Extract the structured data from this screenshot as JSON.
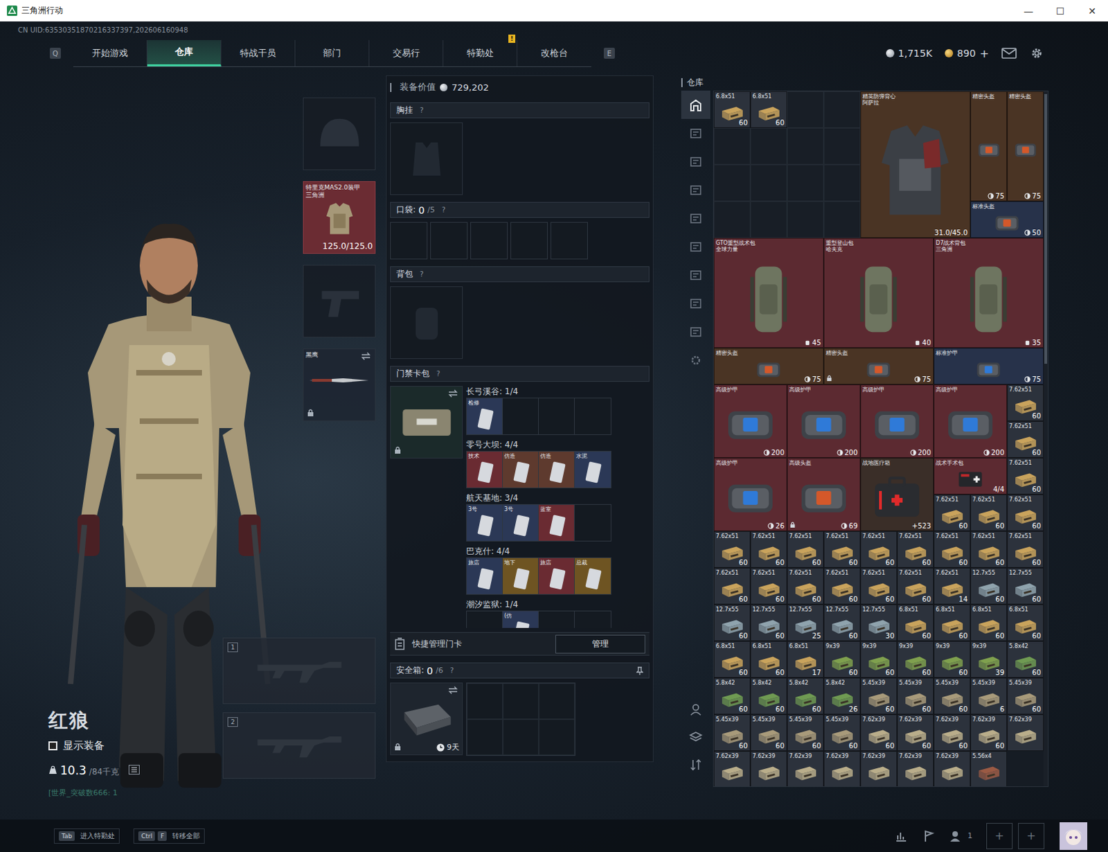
{
  "window": {
    "title": "三角洲行动",
    "controls": [
      "—",
      "☐",
      "✕"
    ]
  },
  "uid": "CN UID:63530351870216337397,202606160948",
  "nav": {
    "left_key": "Q",
    "right_key": "E",
    "tabs": [
      {
        "label": "开始游戏",
        "selected": false
      },
      {
        "label": "仓库",
        "selected": true
      },
      {
        "label": "特战干员",
        "selected": false
      },
      {
        "label": "部门",
        "selected": false
      },
      {
        "label": "交易行",
        "selected": false
      },
      {
        "label": "特勤处",
        "selected": false,
        "badge": "!"
      },
      {
        "label": "改枪台",
        "selected": false
      }
    ]
  },
  "currency": [
    {
      "amount": "1,715K",
      "kind": "silver",
      "suffix": ""
    },
    {
      "amount": "890",
      "kind": "gold",
      "suffix": "+"
    }
  ],
  "operator": {
    "name": "红狼",
    "show_gear": {
      "label": "显示装备",
      "checked": false
    },
    "weight": "10.3",
    "weight_max": "/84千克",
    "status": "[世界_突破数666: 1"
  },
  "slots": {
    "helmet": {
      "filled": false
    },
    "armor": {
      "name": "特里克MAS2.0装甲",
      "sub": "三角洲",
      "durability": "125.0/125.0",
      "color": "#6b2c33"
    },
    "pistol": {
      "filled": false
    },
    "melee": {
      "name": "黑鹰",
      "locked": true
    },
    "weapons": [
      {
        "number": "1"
      },
      {
        "number": "2"
      }
    ]
  },
  "loadout": {
    "value_label": "装备价值",
    "value": "729,202",
    "chest": {
      "label": "胸挂",
      "help": "?"
    },
    "pockets": {
      "label": "口袋:",
      "count": "0",
      "capacity": "/5",
      "help": "?",
      "slots": [
        {
          "filled": false
        },
        {
          "filled": false
        },
        {
          "filled": false
        },
        {
          "filled": false
        },
        {
          "filled": false
        }
      ]
    },
    "backpack": {
      "label": "背包",
      "help": "?"
    },
    "keycards": {
      "label": "门禁卡包",
      "help": "?",
      "locked": true,
      "groups": [
        {
          "name": "长弓溪谷:",
          "count": "1/4",
          "cards": [
            {
              "filled": true,
              "label": "检修",
              "color": "#2b3856"
            },
            {
              "filled": false
            },
            {
              "filled": false
            },
            {
              "filled": false
            }
          ]
        },
        {
          "name": "零号大坝:",
          "count": "4/4",
          "cards": [
            {
              "filled": true,
              "label": "技术",
              "color": "#6a2b32"
            },
            {
              "filled": true,
              "label": "仿造",
              "color": "#5e3a2e"
            },
            {
              "filled": true,
              "label": "仿造",
              "color": "#5e3a2e"
            },
            {
              "filled": true,
              "label": "水泥",
              "color": "#2b3856"
            }
          ]
        },
        {
          "name": "航天基地:",
          "count": "3/4",
          "cards": [
            {
              "filled": true,
              "label": "3号",
              "color": "#2b3856"
            },
            {
              "filled": true,
              "label": "3号",
              "color": "#2b3856"
            },
            {
              "filled": true,
              "label": "蓝室",
              "color": "#6a2b32"
            },
            {
              "filled": false
            }
          ]
        },
        {
          "name": "巴克什:",
          "count": "4/4",
          "cards": [
            {
              "filled": true,
              "label": "旅店",
              "color": "#2b3856"
            },
            {
              "filled": true,
              "label": "地下",
              "color": "#6e5422"
            },
            {
              "filled": true,
              "label": "旅店",
              "color": "#6a2b32"
            },
            {
              "filled": true,
              "label": "总裁",
              "color": "#6e5422"
            }
          ]
        },
        {
          "name": "潮汐监狱:",
          "count": "1/4",
          "cards": [
            {
              "filled": false
            },
            {
              "filled": true,
              "label": "(仿",
              "color": "#2b3856"
            },
            {
              "filled": false
            },
            {
              "filled": false
            }
          ]
        }
      ]
    },
    "quick_manage": {
      "label": "快捷管理门卡",
      "button": "管理"
    },
    "safe": {
      "label": "安全箱:",
      "count": "0",
      "capacity": "/6",
      "help": "?",
      "time": "9天",
      "locked": true,
      "slots": [
        {
          "filled": false
        },
        {
          "filled": false
        },
        {
          "filled": false
        },
        {
          "filled": false
        },
        {
          "filled": false
        },
        {
          "filled": false
        }
      ]
    }
  },
  "storage": {
    "title": "仓库",
    "tabs": [
      {
        "selected": true
      },
      {
        "selected": false
      },
      {
        "selected": false
      },
      {
        "selected": false
      },
      {
        "selected": false
      },
      {
        "selected": false
      },
      {
        "selected": false
      },
      {
        "selected": false
      },
      {
        "selected": false
      },
      {
        "selected": false
      }
    ],
    "items": [
      {
        "kind": "ammo",
        "name": "6.8x51",
        "count": "60",
        "color": "#c9a35c",
        "locked": false
      },
      {
        "kind": "ammo",
        "name": "6.8x51",
        "count": "60",
        "color": "#c9a35c",
        "locked": false
      },
      {
        "kind": "empty"
      },
      {
        "kind": "empty"
      },
      {
        "kind": "vest",
        "name": "精英防弹背心",
        "sub": "阿萨拉",
        "count": "31.0/45.0",
        "color": "#4a3424",
        "locked": false
      },
      {
        "kind": "helmet-tall",
        "name": "精密头盔",
        "count": "75",
        "color": "#4a3424",
        "locked": false
      },
      {
        "kind": "helmet-tall",
        "name": "精密头盔",
        "count": "75",
        "color": "#4a3424",
        "locked": false
      },
      {
        "kind": "empty"
      },
      {
        "kind": "empty"
      },
      {
        "kind": "empty"
      },
      {
        "kind": "empty"
      },
      {
        "kind": "empty"
      },
      {
        "kind": "empty"
      },
      {
        "kind": "empty"
      },
      {
        "kind": "empty"
      },
      {
        "kind": "empty"
      },
      {
        "kind": "empty"
      },
      {
        "kind": "empty"
      },
      {
        "kind": "empty"
      },
      {
        "kind": "helmet-small",
        "name": "标准头盔",
        "count": "50",
        "color": "#27324a",
        "locked": false
      },
      {
        "kind": "backpack",
        "name": "GTO重型战术包",
        "sub": "全球力量",
        "count": "45",
        "color": "#5c2a31",
        "locked": false
      },
      {
        "kind": "backpack",
        "name": "重型登山包",
        "sub": "哈夫克",
        "count": "40",
        "color": "#5c2a31",
        "locked": false
      },
      {
        "kind": "backpack",
        "name": "D7战术背包",
        "sub": "三角洲",
        "count": "35",
        "color": "#5c2a31",
        "locked": false
      },
      {
        "kind": "helmet-wide",
        "name": "精密头盔",
        "count": "75",
        "color": "#4a3424",
        "locked": false
      },
      {
        "kind": "helmet-wide",
        "name": "精密头盔",
        "count": "75",
        "color": "#4a3424",
        "locked": true
      },
      {
        "kind": "armor-wide",
        "name": "标准护甲",
        "count": "75",
        "color": "#27324a",
        "locked": false
      },
      {
        "kind": "armor",
        "name": "高级护甲",
        "count": "200",
        "color": "#5c2a31",
        "locked": false
      },
      {
        "kind": "armor",
        "name": "高级护甲",
        "count": "200",
        "color": "#5c2a31",
        "locked": false
      },
      {
        "kind": "armor",
        "name": "高级护甲",
        "count": "200",
        "color": "#5c2a31",
        "locked": false
      },
      {
        "kind": "armor",
        "name": "高级护甲",
        "count": "200",
        "color": "#5c2a31",
        "locked": false
      },
      {
        "kind": "ammo",
        "name": "7.62x51",
        "count": "60",
        "color": "#c9a35c",
        "locked": false
      },
      {
        "kind": "ammo",
        "name": "7.62x51",
        "count": "60",
        "color": "#c9a35c",
        "locked": false
      },
      {
        "kind": "armor",
        "name": "高级护甲",
        "count": "26",
        "color": "#5c2a31",
        "locked": false
      },
      {
        "kind": "helmet",
        "name": "高级头盔",
        "count": "69",
        "color": "#5c2a31",
        "locked": true
      },
      {
        "kind": "medkit",
        "name": "战地医疗箱",
        "count": "+523",
        "color": "#3a2e28",
        "locked": false
      },
      {
        "kind": "surgery",
        "name": "战术手术包",
        "count": "4/4",
        "color": "#5c2a31",
        "locked": false
      },
      {
        "kind": "ammo",
        "name": "7.62x51",
        "count": "60",
        "color": "#c9a35c",
        "locked": false
      },
      {
        "kind": "ammo",
        "name": "7.62x51",
        "count": "60",
        "color": "#c9a35c",
        "locked": false
      },
      {
        "kind": "ammo",
        "name": "7.62x51",
        "count": "60",
        "color": "#c9a35c",
        "locked": false
      },
      {
        "kind": "ammo",
        "name": "7.62x51",
        "count": "60",
        "color": "#c9a35c",
        "locked": false
      },
      {
        "kind": "ammo",
        "name": "7.62x51",
        "count": "60",
        "color": "#c9a35c",
        "locked": false
      },
      {
        "kind": "ammo",
        "name": "7.62x51",
        "count": "60",
        "color": "#c9a35c",
        "locked": false
      },
      {
        "kind": "ammo",
        "name": "7.62x51",
        "count": "60",
        "color": "#c9a35c",
        "locked": false
      },
      {
        "kind": "ammo",
        "name": "7.62x51",
        "count": "60",
        "color": "#c9a35c",
        "locked": false
      },
      {
        "kind": "ammo",
        "name": "7.62x51",
        "count": "60",
        "color": "#c9a35c",
        "locked": false
      },
      {
        "kind": "ammo",
        "name": "7.62x51",
        "count": "60",
        "color": "#c9a35c",
        "locked": false
      },
      {
        "kind": "ammo",
        "name": "7.62x51",
        "count": "60",
        "color": "#c9a35c",
        "locked": false
      },
      {
        "kind": "ammo",
        "name": "7.62x51",
        "count": "60",
        "color": "#c9a35c",
        "locked": false
      },
      {
        "kind": "ammo",
        "name": "7.62x51",
        "count": "60",
        "color": "#c9a35c",
        "locked": false
      },
      {
        "kind": "ammo",
        "name": "7.62x51",
        "count": "60",
        "color": "#c9a35c",
        "locked": false
      },
      {
        "kind": "ammo",
        "name": "7.62x51",
        "count": "60",
        "color": "#c9a35c",
        "locked": false
      },
      {
        "kind": "ammo",
        "name": "7.62x51",
        "count": "60",
        "color": "#c9a35c",
        "locked": false
      },
      {
        "kind": "ammo",
        "name": "7.62x51",
        "count": "60",
        "color": "#c9a35c",
        "locked": false
      },
      {
        "kind": "ammo",
        "name": "7.62x51",
        "count": "60",
        "color": "#c9a35c",
        "locked": false
      },
      {
        "kind": "ammo",
        "name": "7.62x51",
        "count": "60",
        "color": "#c9a35c",
        "locked": false
      },
      {
        "kind": "ammo",
        "name": "7.62x51",
        "count": "14",
        "color": "#c9a35c",
        "locked": false
      },
      {
        "kind": "ammo",
        "name": "12.7x55",
        "count": "60",
        "color": "#8fa3ad",
        "locked": false
      },
      {
        "kind": "ammo",
        "name": "12.7x55",
        "count": "60",
        "color": "#8fa3ad",
        "locked": false
      },
      {
        "kind": "ammo",
        "name": "12.7x55",
        "count": "60",
        "color": "#8fa3ad",
        "locked": false
      },
      {
        "kind": "ammo",
        "name": "12.7x55",
        "count": "60",
        "color": "#8fa3ad",
        "locked": false
      },
      {
        "kind": "ammo",
        "name": "12.7x55",
        "count": "25",
        "color": "#8fa3ad",
        "locked": false
      },
      {
        "kind": "ammo",
        "name": "12.7x55",
        "count": "60",
        "color": "#8fa3ad",
        "locked": false
      },
      {
        "kind": "ammo",
        "name": "12.7x55",
        "count": "30",
        "color": "#8fa3ad",
        "locked": false
      },
      {
        "kind": "ammo",
        "name": "6.8x51",
        "count": "60",
        "color": "#c9a35c",
        "locked": false
      },
      {
        "kind": "ammo",
        "name": "6.8x51",
        "count": "60",
        "color": "#c9a35c",
        "locked": false
      },
      {
        "kind": "ammo",
        "name": "6.8x51",
        "count": "60",
        "color": "#c9a35c",
        "locked": false
      },
      {
        "kind": "ammo",
        "name": "6.8x51",
        "count": "60",
        "color": "#c9a35c",
        "locked": false
      },
      {
        "kind": "ammo",
        "name": "6.8x51",
        "count": "60",
        "color": "#c9a35c",
        "locked": false
      },
      {
        "kind": "ammo",
        "name": "6.8x51",
        "count": "60",
        "color": "#c9a35c",
        "locked": false
      },
      {
        "kind": "ammo",
        "name": "6.8x51",
        "count": "17",
        "color": "#c9a35c",
        "locked": false
      },
      {
        "kind": "ammo",
        "name": "9x39",
        "count": "60",
        "color": "#7fa04e",
        "locked": false
      },
      {
        "kind": "ammo",
        "name": "9x39",
        "count": "60",
        "color": "#7fa04e",
        "locked": false
      },
      {
        "kind": "ammo",
        "name": "9x39",
        "count": "60",
        "color": "#7fa04e",
        "locked": false
      },
      {
        "kind": "ammo",
        "name": "9x39",
        "count": "60",
        "color": "#7fa04e",
        "locked": false
      },
      {
        "kind": "ammo",
        "name": "9x39",
        "count": "39",
        "color": "#7fa04e",
        "locked": false
      },
      {
        "kind": "ammo",
        "name": "5.8x42",
        "count": "60",
        "color": "#6f9a52",
        "locked": false
      },
      {
        "kind": "ammo",
        "name": "5.8x42",
        "count": "60",
        "color": "#6f9a52",
        "locked": false
      },
      {
        "kind": "ammo",
        "name": "5.8x42",
        "count": "60",
        "color": "#6f9a52",
        "locked": false
      },
      {
        "kind": "ammo",
        "name": "5.8x42",
        "count": "60",
        "color": "#6f9a52",
        "locked": false
      },
      {
        "kind": "ammo",
        "name": "5.8x42",
        "count": "26",
        "color": "#6f9a52",
        "locked": false
      },
      {
        "kind": "ammo",
        "name": "5.45x39",
        "count": "60",
        "color": "#a89a7a",
        "locked": false
      },
      {
        "kind": "ammo",
        "name": "5.45x39",
        "count": "60",
        "color": "#a89a7a",
        "locked": false
      },
      {
        "kind": "ammo",
        "name": "5.45x39",
        "count": "60",
        "color": "#a89a7a",
        "locked": false
      },
      {
        "kind": "ammo",
        "name": "5.45x39",
        "count": "6",
        "color": "#a89a7a",
        "locked": false
      },
      {
        "kind": "ammo",
        "name": "5.45x39",
        "count": "60",
        "color": "#a89a7a",
        "locked": false
      },
      {
        "kind": "ammo",
        "name": "5.45x39",
        "count": "60",
        "color": "#a89a7a",
        "locked": false
      },
      {
        "kind": "ammo",
        "name": "5.45x39",
        "count": "60",
        "color": "#a89a7a",
        "locked": false
      },
      {
        "kind": "ammo",
        "name": "5.45x39",
        "count": "60",
        "color": "#a89a7a",
        "locked": false
      },
      {
        "kind": "ammo",
        "name": "5.45x39",
        "count": "60",
        "color": "#a89a7a",
        "locked": false
      },
      {
        "kind": "ammo",
        "name": "7.62x39",
        "count": "60",
        "color": "#b9ad8a",
        "locked": false
      },
      {
        "kind": "ammo",
        "name": "7.62x39",
        "count": "60",
        "color": "#b9ad8a",
        "locked": false
      },
      {
        "kind": "ammo",
        "name": "7.62x39",
        "count": "60",
        "color": "#b9ad8a",
        "locked": false
      },
      {
        "kind": "ammo",
        "name": "7.62x39",
        "count": "60",
        "color": "#b9ad8a",
        "locked": false
      },
      {
        "kind": "ammo",
        "name": "7.62x39",
        "color": "#b9ad8a",
        "locked": false
      },
      {
        "kind": "ammo",
        "name": "7.62x39",
        "color": "#b9ad8a",
        "locked": false
      },
      {
        "kind": "ammo",
        "name": "7.62x39",
        "color": "#b9ad8a",
        "locked": false
      },
      {
        "kind": "ammo",
        "name": "7.62x39",
        "color": "#b9ad8a",
        "locked": false
      },
      {
        "kind": "ammo",
        "name": "7.62x39",
        "color": "#b9ad8a",
        "locked": false
      },
      {
        "kind": "ammo",
        "name": "7.62x39",
        "color": "#b9ad8a",
        "locked": false
      },
      {
        "kind": "ammo",
        "name": "7.62x39",
        "color": "#b9ad8a",
        "locked": false
      },
      {
        "kind": "ammo",
        "name": "7.62x39",
        "color": "#b9ad8a",
        "locked": false
      },
      {
        "kind": "ammo",
        "name": "5.56x4",
        "color": "#9a5a44",
        "locked": false
      }
    ]
  },
  "bottom_bar": {
    "hints": [
      {
        "keys": [
          "Tab"
        ],
        "label": "进入特勤处"
      },
      {
        "keys": [
          "Ctrl",
          "F"
        ],
        "label": "转移全部"
      }
    ],
    "friends": "1",
    "add_buttons": [
      "+",
      "+"
    ]
  }
}
